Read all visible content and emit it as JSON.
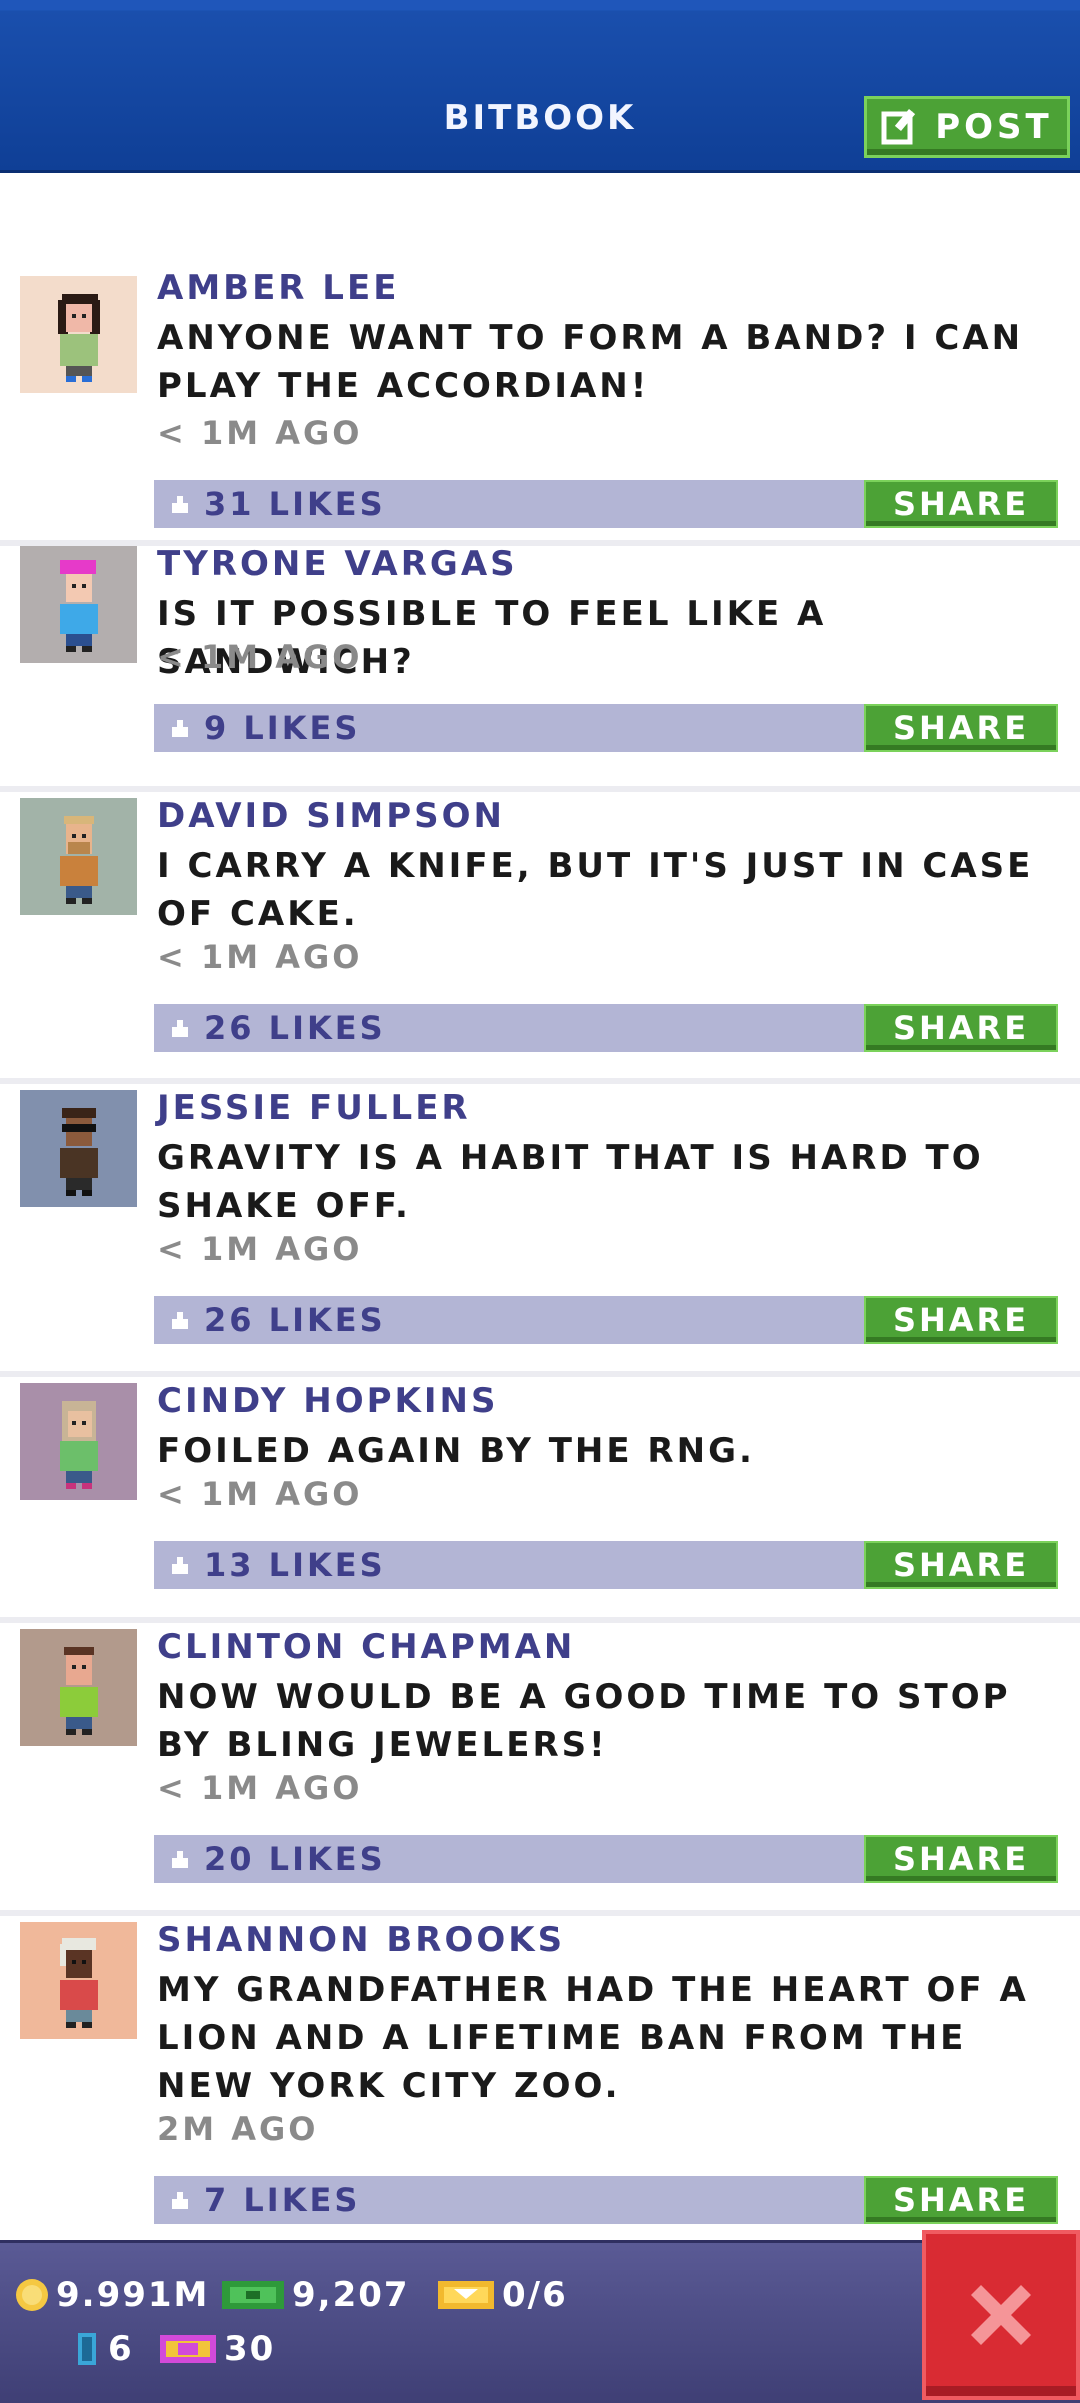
{
  "header": {
    "title": "BITBOOK",
    "post_label": "POST"
  },
  "posts": [
    {
      "name": "AMBER LEE",
      "text": "ANYONE WANT TO FORM A BAND? I CAN PLAY THE ACCORDIAN!",
      "time": "< 1M AGO",
      "likes": "31 LIKES",
      "share": "SHARE"
    },
    {
      "name": "TYRONE VARGAS",
      "text": "IS IT POSSIBLE TO FEEL LIKE A SANDWICH?",
      "time": "< 1M AGO",
      "likes": "9 LIKES",
      "share": "SHARE"
    },
    {
      "name": "DAVID SIMPSON",
      "text": "I CARRY A KNIFE, BUT IT'S JUST IN CASE OF CAKE.",
      "time": "< 1M AGO",
      "likes": "26 LIKES",
      "share": "SHARE"
    },
    {
      "name": "JESSIE FULLER",
      "text": "GRAVITY IS A HABIT THAT IS HARD TO SHAKE OFF.",
      "time": "< 1M AGO",
      "likes": "26 LIKES",
      "share": "SHARE"
    },
    {
      "name": "CINDY HOPKINS",
      "text": "FOILED AGAIN BY THE RNG.",
      "time": "< 1M AGO",
      "likes": "13 LIKES",
      "share": "SHARE"
    },
    {
      "name": "CLINTON CHAPMAN",
      "text": "NOW WOULD BE A GOOD TIME TO STOP BY BLING JEWELERS!",
      "time": "< 1M AGO",
      "likes": "20 LIKES",
      "share": "SHARE"
    },
    {
      "name": "SHANNON BROOKS",
      "text": "MY GRANDFATHER HAD THE HEART OF A LION AND A LIFETIME BAN FROM THE NEW YORK CITY ZOO.",
      "time": "2M AGO",
      "likes": "7 LIKES",
      "share": "SHARE"
    }
  ],
  "footer": {
    "coins": "9.991M",
    "bux": "9,207",
    "tickets": "0/6",
    "elevator": "6",
    "vip": "30"
  },
  "colors": {
    "header": "#0f3f96",
    "button_green": "#4ca236",
    "likes_bar": "#b3b5d5",
    "name": "#3f3f8a",
    "close": "#d92b33"
  }
}
